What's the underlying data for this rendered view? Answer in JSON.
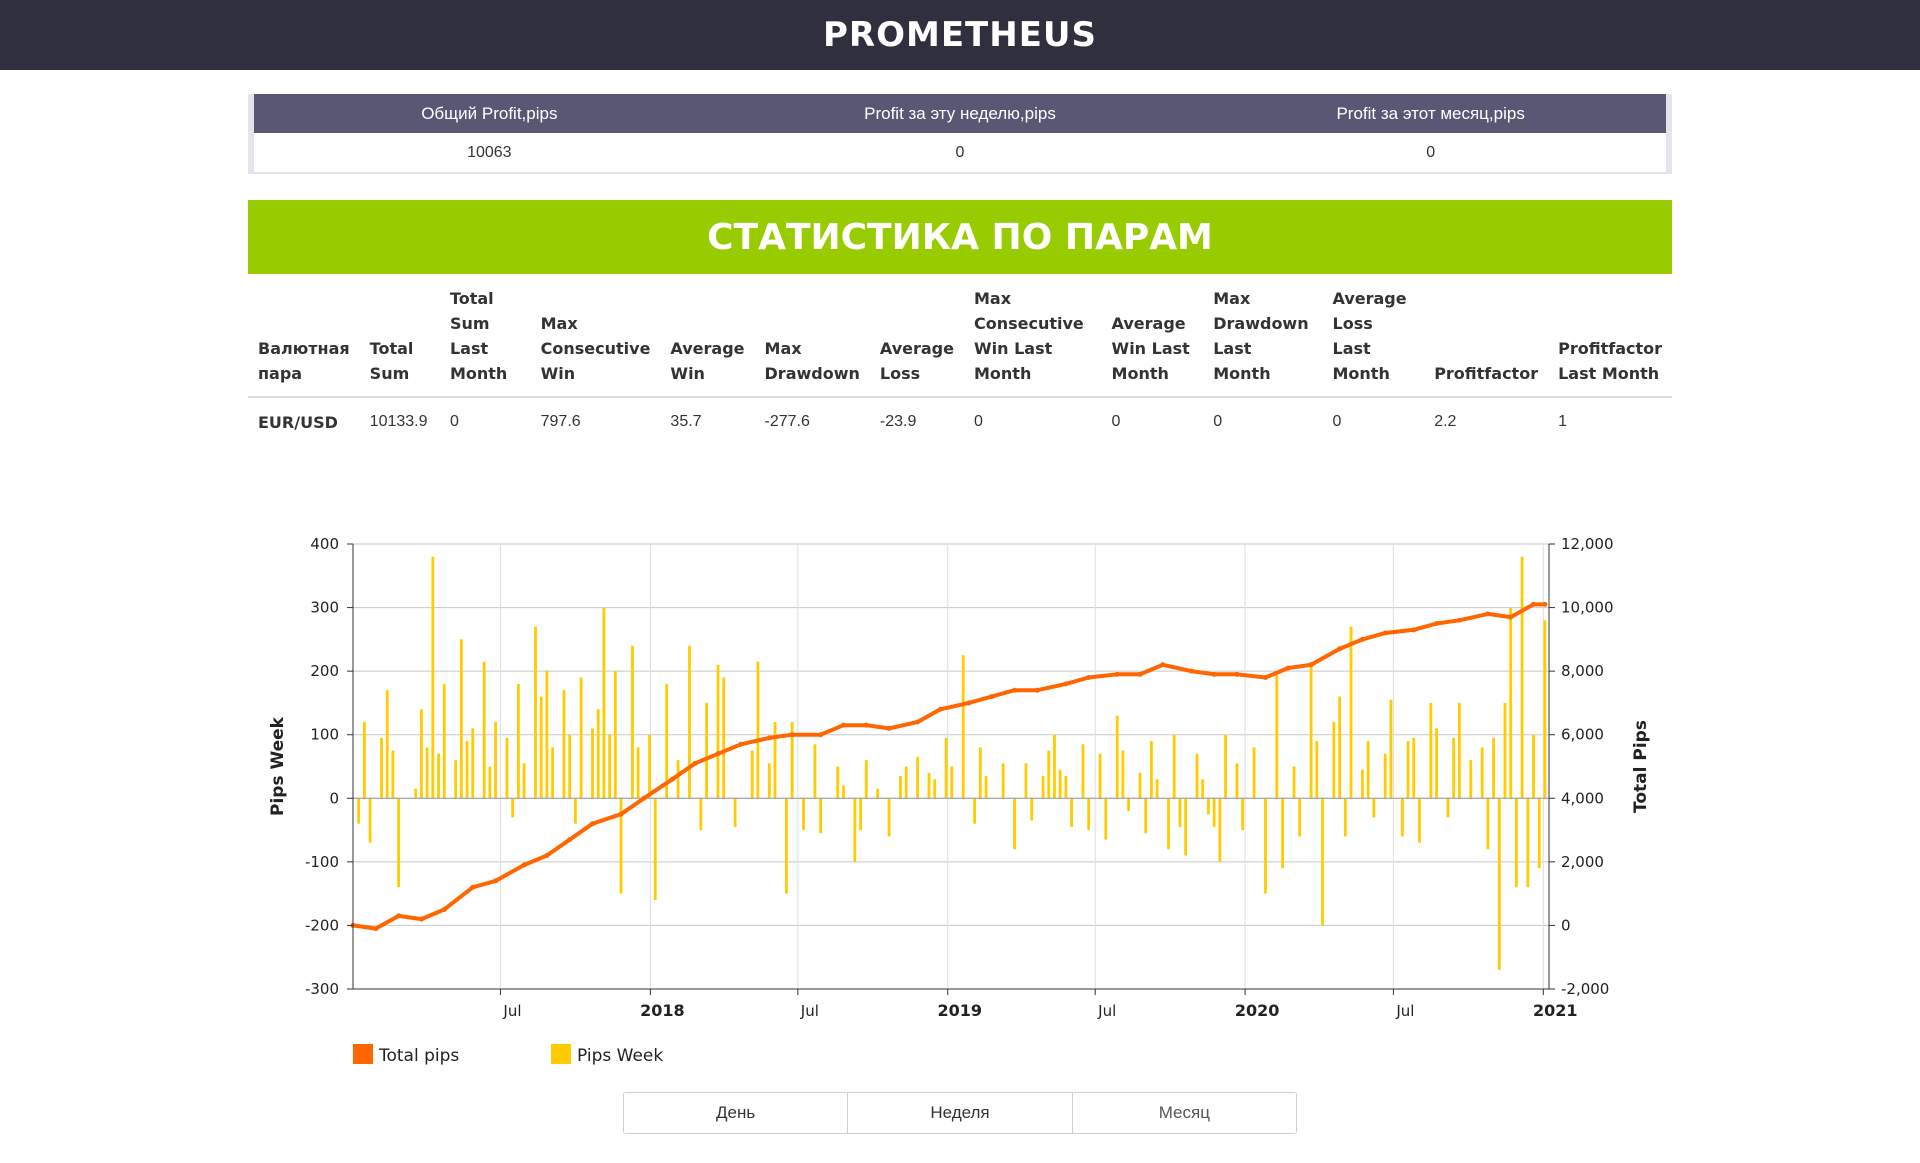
{
  "header": {
    "title": "PROMETHEUS"
  },
  "summary": {
    "headers": [
      "Общий Profit,pips",
      "Profit за эту неделю,pips",
      "Profit за этот месяц,pips"
    ],
    "values": [
      "10063",
      "0",
      "0"
    ]
  },
  "banner": {
    "title": "СТАТИСТИКА ПО ПАРАМ"
  },
  "pairs_table": {
    "headers": [
      "Валютная пара",
      "Total Sum",
      "Total Sum Last Month",
      "Max Consecutive Win",
      "Average Win",
      "Max Drawdown",
      "Average Loss",
      "Max Consecutive Win Last Month",
      "Average Win Last Month",
      "Max Drawdown Last Month",
      "Average Loss Last Month",
      "Profitfactor",
      "Profitfactor Last Month"
    ],
    "rows": [
      [
        "EUR/USD",
        "10133.9",
        "0",
        "797.6",
        "35.7",
        "-277.6",
        "-23.9",
        "0",
        "0",
        "0",
        "0",
        "2.2",
        "1"
      ]
    ]
  },
  "range_buttons": [
    "День",
    "Неделя",
    "Месяц"
  ],
  "chart_data": {
    "type": "bar+line",
    "x_start": "2017-01-01",
    "x_end": "2021-01-08",
    "x_tick_labels": [
      {
        "date": "2017-07-01",
        "label": "Jul",
        "bold": false
      },
      {
        "date": "2018-01-01",
        "label": "2018",
        "bold": true
      },
      {
        "date": "2018-07-01",
        "label": "Jul",
        "bold": false
      },
      {
        "date": "2019-01-01",
        "label": "2019",
        "bold": true
      },
      {
        "date": "2019-07-01",
        "label": "Jul",
        "bold": false
      },
      {
        "date": "2020-01-01",
        "label": "2020",
        "bold": true
      },
      {
        "date": "2020-07-01",
        "label": "Jul",
        "bold": false
      },
      {
        "date": "2021-01-01",
        "label": "2021",
        "bold": true
      }
    ],
    "y_left": {
      "label": "Pips Week",
      "ylim": [
        -300,
        400
      ],
      "ticks": [
        "400",
        "300",
        "200",
        "100",
        "0",
        "-100",
        "-200",
        "-300"
      ]
    },
    "y_right": {
      "label": "Total Pips",
      "ylim": [
        -2000,
        12000
      ],
      "ticks": [
        "12,000",
        "10,000",
        "8,000",
        "6,000",
        "4,000",
        "2,000",
        "0",
        "-2,000"
      ]
    },
    "grid": true,
    "legend_position": "bottom-left",
    "series": [
      {
        "name": "Total pips",
        "color": "#ff6600",
        "axis": "right",
        "type": "line",
        "points": [
          [
            "2017-01-01",
            0
          ],
          [
            "2017-01-29",
            -100
          ],
          [
            "2017-02-26",
            300
          ],
          [
            "2017-03-26",
            200
          ],
          [
            "2017-04-23",
            500
          ],
          [
            "2017-05-28",
            1200
          ],
          [
            "2017-06-25",
            1400
          ],
          [
            "2017-07-30",
            1900
          ],
          [
            "2017-08-27",
            2200
          ],
          [
            "2017-09-24",
            2700
          ],
          [
            "2017-10-22",
            3200
          ],
          [
            "2017-11-26",
            3500
          ],
          [
            "2017-12-24",
            4000
          ],
          [
            "2018-01-28",
            4600
          ],
          [
            "2018-02-25",
            5100
          ],
          [
            "2018-03-25",
            5400
          ],
          [
            "2018-04-22",
            5700
          ],
          [
            "2018-05-27",
            5900
          ],
          [
            "2018-06-24",
            6000
          ],
          [
            "2018-07-29",
            6000
          ],
          [
            "2018-08-26",
            6300
          ],
          [
            "2018-09-23",
            6300
          ],
          [
            "2018-10-21",
            6200
          ],
          [
            "2018-11-25",
            6400
          ],
          [
            "2018-12-23",
            6800
          ],
          [
            "2019-01-27",
            7000
          ],
          [
            "2019-02-24",
            7200
          ],
          [
            "2019-03-24",
            7400
          ],
          [
            "2019-04-21",
            7400
          ],
          [
            "2019-05-26",
            7600
          ],
          [
            "2019-06-23",
            7800
          ],
          [
            "2019-07-28",
            7900
          ],
          [
            "2019-08-25",
            7900
          ],
          [
            "2019-09-22",
            8200
          ],
          [
            "2019-10-27",
            8000
          ],
          [
            "2019-11-24",
            7900
          ],
          [
            "2019-12-22",
            7900
          ],
          [
            "2020-01-26",
            7800
          ],
          [
            "2020-02-23",
            8100
          ],
          [
            "2020-03-22",
            8200
          ],
          [
            "2020-04-26",
            8700
          ],
          [
            "2020-05-24",
            9000
          ],
          [
            "2020-06-21",
            9200
          ],
          [
            "2020-07-26",
            9300
          ],
          [
            "2020-08-23",
            9500
          ],
          [
            "2020-09-20",
            9600
          ],
          [
            "2020-10-25",
            9800
          ],
          [
            "2020-11-22",
            9700
          ],
          [
            "2020-12-20",
            10100
          ],
          [
            "2021-01-03",
            10100
          ]
        ]
      },
      {
        "name": "Pips Week",
        "color": "#ffcc00",
        "axis": "left",
        "type": "column",
        "points": [
          [
            "2017-01-08",
            -40
          ],
          [
            "2017-01-15",
            120
          ],
          [
            "2017-01-22",
            -70
          ],
          [
            "2017-02-05",
            95
          ],
          [
            "2017-02-12",
            170
          ],
          [
            "2017-02-19",
            75
          ],
          [
            "2017-02-26",
            -140
          ],
          [
            "2017-03-19",
            15
          ],
          [
            "2017-03-26",
            140
          ],
          [
            "2017-04-02",
            80
          ],
          [
            "2017-04-09",
            380
          ],
          [
            "2017-04-16",
            70
          ],
          [
            "2017-04-23",
            180
          ],
          [
            "2017-05-07",
            60
          ],
          [
            "2017-05-14",
            250
          ],
          [
            "2017-05-21",
            90
          ],
          [
            "2017-05-28",
            110
          ],
          [
            "2017-06-11",
            215
          ],
          [
            "2017-06-18",
            50
          ],
          [
            "2017-06-25",
            120
          ],
          [
            "2017-07-09",
            95
          ],
          [
            "2017-07-16",
            -30
          ],
          [
            "2017-07-23",
            180
          ],
          [
            "2017-07-30",
            55
          ],
          [
            "2017-08-13",
            270
          ],
          [
            "2017-08-20",
            160
          ],
          [
            "2017-08-27",
            200
          ],
          [
            "2017-09-03",
            80
          ],
          [
            "2017-09-17",
            170
          ],
          [
            "2017-09-24",
            100
          ],
          [
            "2017-10-01",
            -40
          ],
          [
            "2017-10-08",
            190
          ],
          [
            "2017-10-22",
            110
          ],
          [
            "2017-10-29",
            140
          ],
          [
            "2017-11-05",
            300
          ],
          [
            "2017-11-12",
            100
          ],
          [
            "2017-11-19",
            200
          ],
          [
            "2017-11-26",
            -150
          ],
          [
            "2017-12-10",
            240
          ],
          [
            "2017-12-17",
            80
          ],
          [
            "2017-12-31",
            100
          ],
          [
            "2018-01-07",
            -160
          ],
          [
            "2018-01-21",
            180
          ],
          [
            "2018-02-04",
            60
          ],
          [
            "2018-02-18",
            240
          ],
          [
            "2018-03-04",
            -50
          ],
          [
            "2018-03-11",
            150
          ],
          [
            "2018-03-25",
            210
          ],
          [
            "2018-04-01",
            190
          ],
          [
            "2018-04-15",
            -45
          ],
          [
            "2018-05-06",
            75
          ],
          [
            "2018-05-13",
            215
          ],
          [
            "2018-05-27",
            55
          ],
          [
            "2018-06-03",
            120
          ],
          [
            "2018-06-17",
            -150
          ],
          [
            "2018-06-24",
            120
          ],
          [
            "2018-07-08",
            -50
          ],
          [
            "2018-07-22",
            85
          ],
          [
            "2018-07-29",
            -55
          ],
          [
            "2018-08-19",
            50
          ],
          [
            "2018-08-26",
            20
          ],
          [
            "2018-09-09",
            -100
          ],
          [
            "2018-09-16",
            -50
          ],
          [
            "2018-09-23",
            60
          ],
          [
            "2018-10-07",
            15
          ],
          [
            "2018-10-21",
            -60
          ],
          [
            "2018-11-04",
            35
          ],
          [
            "2018-11-11",
            50
          ],
          [
            "2018-11-25",
            65
          ],
          [
            "2018-12-09",
            40
          ],
          [
            "2018-12-16",
            30
          ],
          [
            "2018-12-30",
            95
          ],
          [
            "2019-01-06",
            50
          ],
          [
            "2019-01-20",
            225
          ],
          [
            "2019-02-03",
            -40
          ],
          [
            "2019-02-10",
            80
          ],
          [
            "2019-02-17",
            35
          ],
          [
            "2019-03-10",
            55
          ],
          [
            "2019-03-24",
            -80
          ],
          [
            "2019-04-07",
            55
          ],
          [
            "2019-04-14",
            -35
          ],
          [
            "2019-04-28",
            35
          ],
          [
            "2019-05-05",
            75
          ],
          [
            "2019-05-12",
            100
          ],
          [
            "2019-05-19",
            45
          ],
          [
            "2019-05-26",
            35
          ],
          [
            "2019-06-02",
            -45
          ],
          [
            "2019-06-16",
            85
          ],
          [
            "2019-06-23",
            -50
          ],
          [
            "2019-07-07",
            70
          ],
          [
            "2019-07-14",
            -65
          ],
          [
            "2019-07-28",
            130
          ],
          [
            "2019-08-04",
            75
          ],
          [
            "2019-08-11",
            -20
          ],
          [
            "2019-08-25",
            40
          ],
          [
            "2019-09-01",
            -55
          ],
          [
            "2019-09-08",
            90
          ],
          [
            "2019-09-15",
            30
          ],
          [
            "2019-09-29",
            -80
          ],
          [
            "2019-10-06",
            100
          ],
          [
            "2019-10-13",
            -45
          ],
          [
            "2019-10-20",
            -90
          ],
          [
            "2019-11-03",
            70
          ],
          [
            "2019-11-10",
            30
          ],
          [
            "2019-11-17",
            -25
          ],
          [
            "2019-11-24",
            -45
          ],
          [
            "2019-12-01",
            -100
          ],
          [
            "2019-12-08",
            100
          ],
          [
            "2019-12-22",
            55
          ],
          [
            "2019-12-29",
            -50
          ],
          [
            "2020-01-12",
            80
          ],
          [
            "2020-01-26",
            -150
          ],
          [
            "2020-02-09",
            200
          ],
          [
            "2020-02-16",
            -110
          ],
          [
            "2020-03-01",
            50
          ],
          [
            "2020-03-08",
            -60
          ],
          [
            "2020-03-22",
            210
          ],
          [
            "2020-03-29",
            90
          ],
          [
            "2020-04-05",
            -200
          ],
          [
            "2020-04-19",
            120
          ],
          [
            "2020-04-26",
            160
          ],
          [
            "2020-05-03",
            -60
          ],
          [
            "2020-05-10",
            270
          ],
          [
            "2020-05-24",
            45
          ],
          [
            "2020-05-31",
            90
          ],
          [
            "2020-06-07",
            -30
          ],
          [
            "2020-06-21",
            70
          ],
          [
            "2020-06-28",
            155
          ],
          [
            "2020-07-12",
            -60
          ],
          [
            "2020-07-19",
            90
          ],
          [
            "2020-07-26",
            95
          ],
          [
            "2020-08-02",
            -70
          ],
          [
            "2020-08-16",
            150
          ],
          [
            "2020-08-23",
            110
          ],
          [
            "2020-09-06",
            -30
          ],
          [
            "2020-09-13",
            95
          ],
          [
            "2020-09-20",
            150
          ],
          [
            "2020-10-04",
            60
          ],
          [
            "2020-10-18",
            80
          ],
          [
            "2020-10-25",
            -80
          ],
          [
            "2020-11-01",
            95
          ],
          [
            "2020-11-08",
            -270
          ],
          [
            "2020-11-15",
            150
          ],
          [
            "2020-11-22",
            300
          ],
          [
            "2020-11-29",
            -140
          ],
          [
            "2020-12-06",
            380
          ],
          [
            "2020-12-13",
            -140
          ],
          [
            "2020-12-20",
            100
          ],
          [
            "2020-12-27",
            -110
          ],
          [
            "2021-01-03",
            280
          ]
        ]
      }
    ]
  }
}
